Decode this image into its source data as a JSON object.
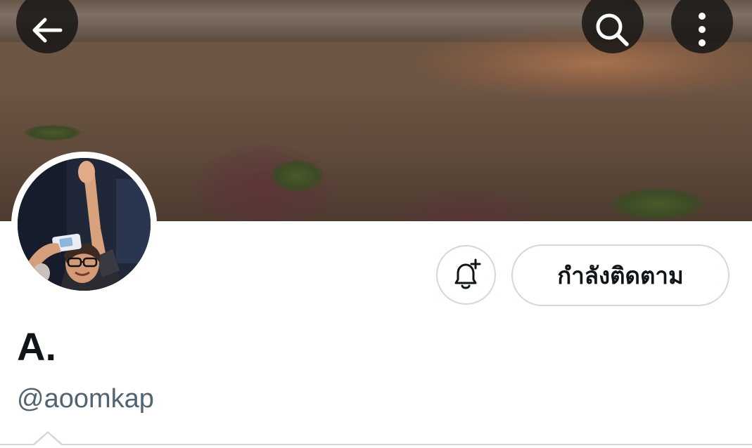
{
  "header": {
    "back_icon": "arrow-left-icon",
    "search_icon": "search-icon",
    "more_icon": "more-vertical-icon"
  },
  "profile": {
    "display_name": "A.",
    "handle": "@aoomkap",
    "bell_icon": "bell-plus-icon",
    "following_label": "กำลังติดตาม"
  },
  "colors": {
    "text_primary": "#0f1419",
    "text_secondary": "#536471",
    "border": "#cfd9de",
    "icon_button_bg": "#141414"
  }
}
